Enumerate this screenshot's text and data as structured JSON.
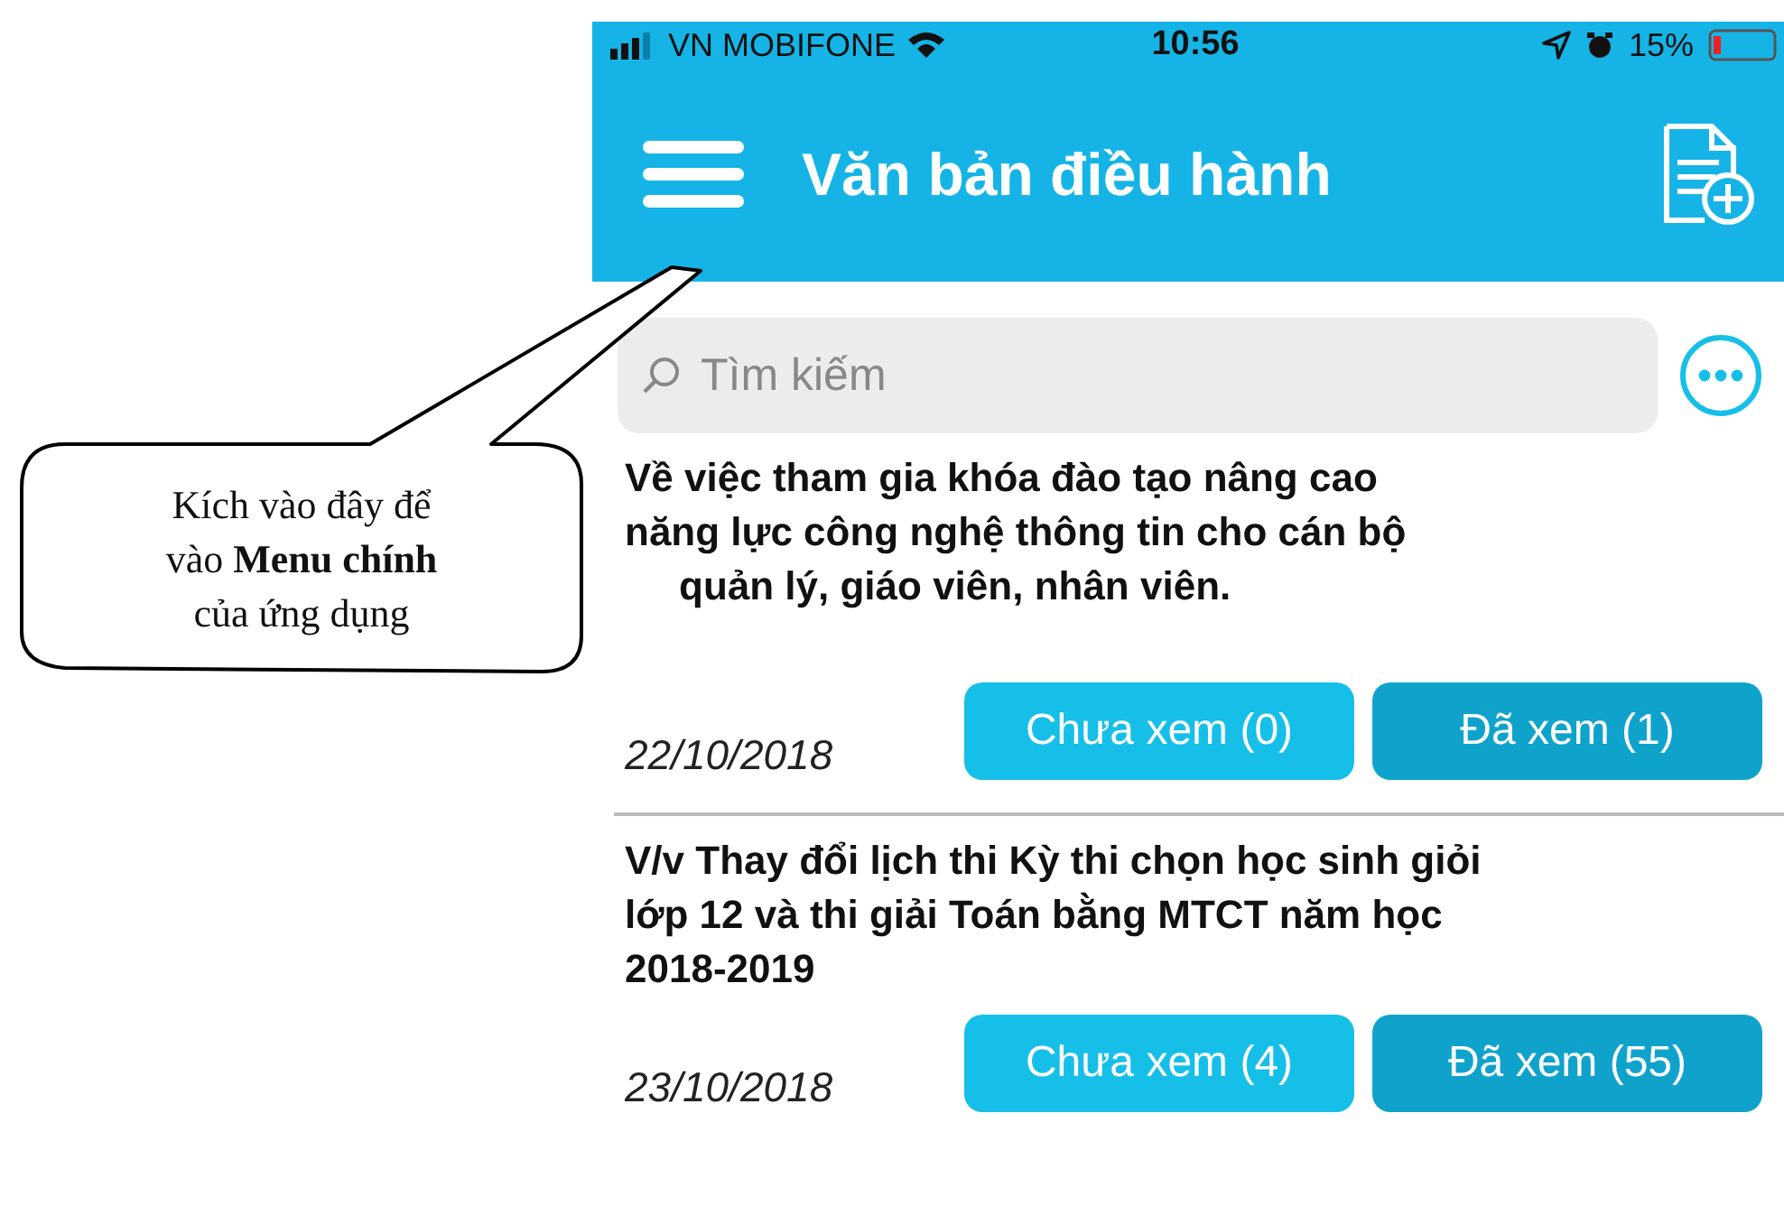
{
  "status_bar": {
    "carrier": "VN MOBIFONE",
    "time": "10:56",
    "battery": "15%"
  },
  "header": {
    "title": "Văn bản điều hành"
  },
  "search": {
    "placeholder": "Tìm kiếm"
  },
  "documents": [
    {
      "title_lines": [
        "Về việc tham gia khóa đào tạo nâng cao",
        "năng lực công nghệ thông tin cho cán bộ",
        "quản lý, giáo viên, nhân viên."
      ],
      "date": "22/10/2018",
      "buttons": [
        {
          "label": "Chưa xem (0)",
          "kind": "unread"
        },
        {
          "label": "Đã xem (1)",
          "kind": "read"
        }
      ]
    },
    {
      "title_lines": [
        "V/v Thay đổi lịch thi Kỳ thi chọn học sinh giỏi",
        "lớp 12 và thi giải Toán bằng MTCT năm học",
        "2018-2019"
      ],
      "date": "23/10/2018",
      "buttons": [
        {
          "label": "Chưa xem (4)",
          "kind": "unread"
        },
        {
          "label": "Đã xem (55)",
          "kind": "read"
        }
      ]
    }
  ],
  "callout": {
    "lines": [
      "Kích vào đây để",
      "vào **Menu chính**",
      "của ứng dụng"
    ]
  }
}
